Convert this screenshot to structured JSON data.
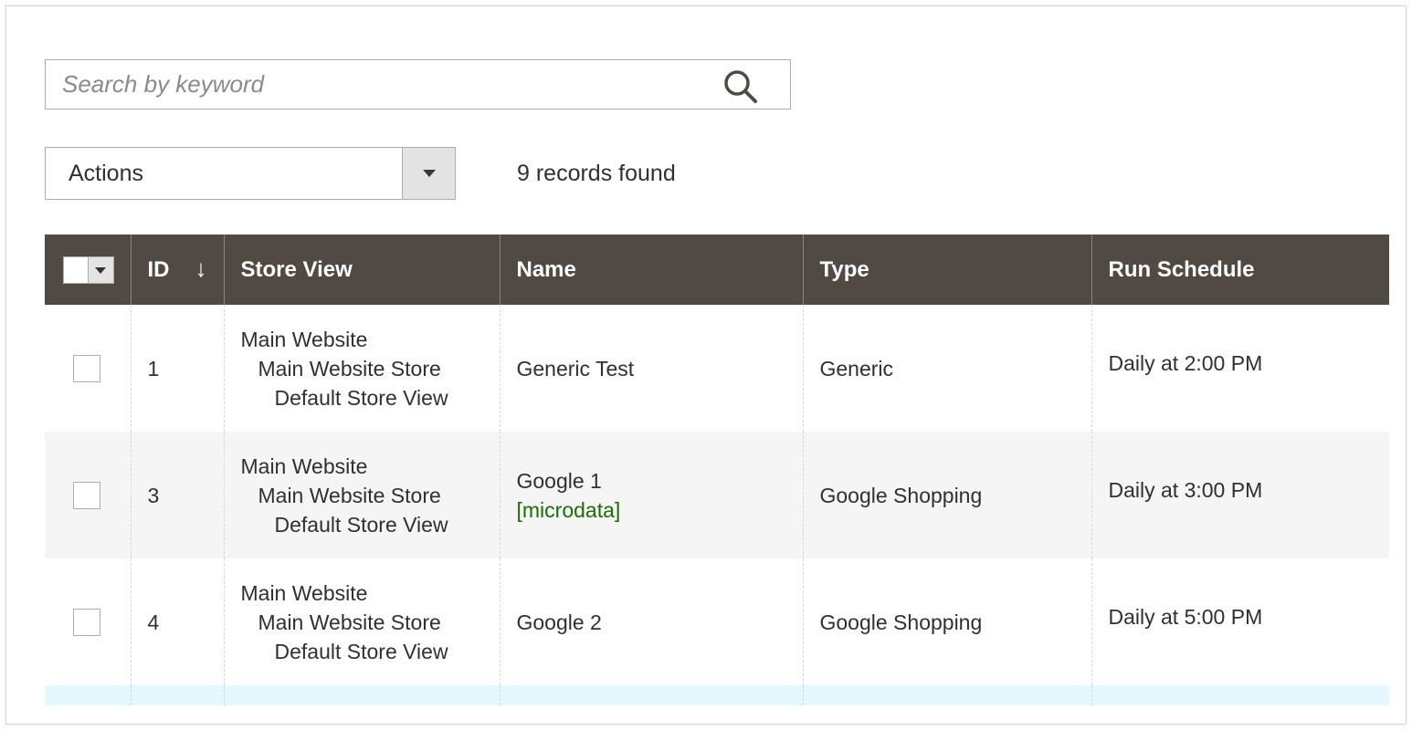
{
  "search": {
    "placeholder": "Search by keyword",
    "icon": "search-icon"
  },
  "toolbar": {
    "actions_label": "Actions",
    "records_found": "9 records found"
  },
  "grid": {
    "columns": {
      "id": "ID",
      "store_view": "Store View",
      "name": "Name",
      "type": "Type",
      "run_schedule": "Run Schedule"
    },
    "sort_indicator": "↓",
    "rows": [
      {
        "id": "1",
        "store_view": [
          "Main Website",
          "Main Website Store",
          "Default Store View"
        ],
        "name": "Generic Test",
        "name_tag": "",
        "type": "Generic",
        "run_schedule": "Daily at 2:00 PM"
      },
      {
        "id": "3",
        "store_view": [
          "Main Website",
          "Main Website Store",
          "Default Store View"
        ],
        "name": "Google 1",
        "name_tag": "[microdata]",
        "type": "Google Shopping",
        "run_schedule": "Daily at 3:00 PM"
      },
      {
        "id": "4",
        "store_view": [
          "Main Website",
          "Main Website Store",
          "Default Store View"
        ],
        "name": "Google 2",
        "name_tag": "",
        "type": "Google Shopping",
        "run_schedule": "Daily at 5:00 PM"
      }
    ]
  },
  "colors": {
    "header_bg": "#514943",
    "alt_row_bg": "#f5f5f5",
    "highlight_row_bg": "#e5f7fe",
    "microdata_text": "#1c6b04"
  }
}
